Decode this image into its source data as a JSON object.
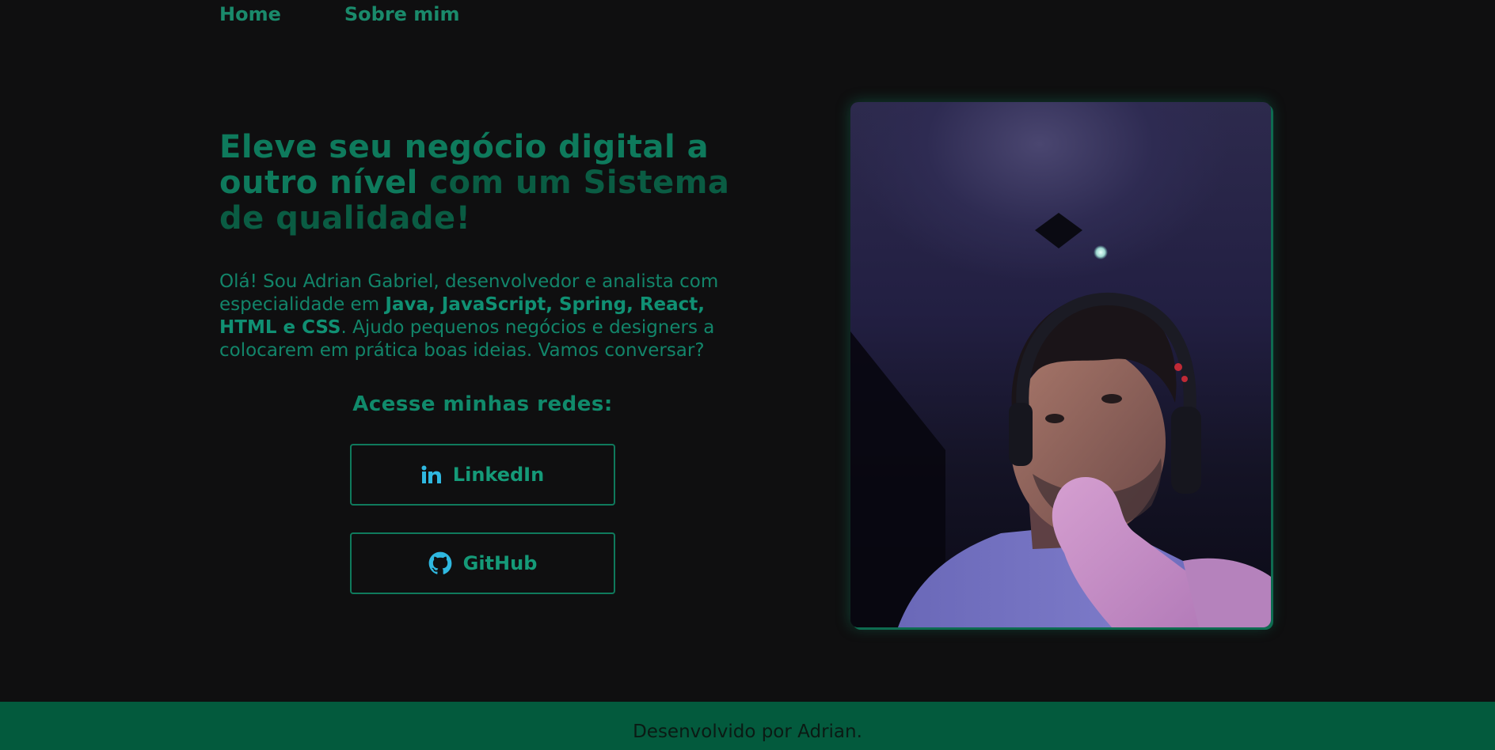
{
  "nav": {
    "items": [
      {
        "label": "Home"
      },
      {
        "label": "Sobre mim"
      }
    ]
  },
  "hero": {
    "headline_part1": "Eleve seu negócio digital a outro nível",
    "headline_part2": " com um Sistema de qualidade!",
    "intro_before": "Olá! Sou Adrian Gabriel, desenvolvedor e analista com especialidade em ",
    "intro_bold": "Java, JavaScript, Spring, React, HTML e CSS",
    "intro_after": ". Ajudo pequenos negócios e designers a colocarem em prática boas ideias. Vamos conversar?",
    "social_title": "Acesse minhas redes:",
    "links": [
      {
        "label": "LinkedIn",
        "icon": "linkedin-icon"
      },
      {
        "label": "GitHub",
        "icon": "github-icon"
      }
    ]
  },
  "footer": {
    "text": "Desenvolvido por Adrian."
  },
  "colors": {
    "background": "#0f0f10",
    "accent": "#0e7a5c",
    "footer": "#035a3d",
    "icon": "#2fb8e0"
  }
}
